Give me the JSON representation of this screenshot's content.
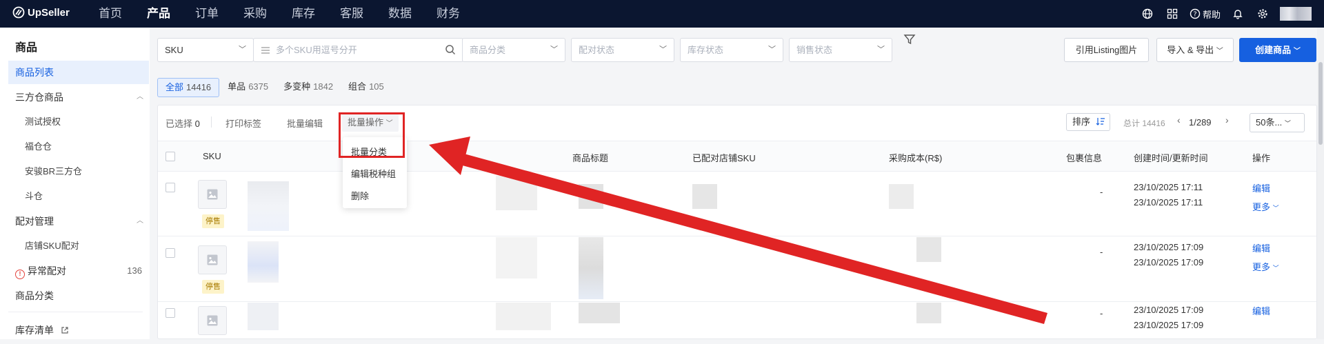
{
  "app": {
    "logo": "UpSeller"
  },
  "nav": [
    "首页",
    "产品",
    "订单",
    "采购",
    "库存",
    "客服",
    "数据",
    "财务"
  ],
  "nav_active": "产品",
  "topbar": {
    "help": "帮助"
  },
  "sidebar": {
    "title": "商品",
    "items": [
      {
        "label": "商品列表"
      },
      {
        "label": "三方仓商品"
      },
      {
        "label": "测试授权"
      },
      {
        "label": "福仓仓"
      },
      {
        "label": "安骏BR三方仓"
      },
      {
        "label": "斗仓"
      },
      {
        "label": "配对管理"
      },
      {
        "label": "店铺SKU配对"
      },
      {
        "label": "异常配对",
        "count": "136"
      },
      {
        "label": "商品分类"
      },
      {
        "label": "库存清单"
      }
    ]
  },
  "filters": {
    "sku_select": "SKU",
    "search_placeholder": "多个SKU用逗号分开",
    "category": "商品分类",
    "pair_status": "配对状态",
    "stock_status": "库存状态",
    "sale_status": "销售状态"
  },
  "buttons": {
    "listing_images": "引用Listing图片",
    "import_export": "导入 & 导出",
    "create": "创建商品"
  },
  "tabs": [
    {
      "label": "全部",
      "count": "14416"
    },
    {
      "label": "单品",
      "count": "6375"
    },
    {
      "label": "多变种",
      "count": "1842"
    },
    {
      "label": "组合",
      "count": "105"
    }
  ],
  "toolbar": {
    "selected_label": "已选择",
    "selected_count": "0",
    "print_labels": "打印标签",
    "bulk_edit": "批量编辑",
    "bulk_ops": "批量操作",
    "sort": "排序",
    "total": "总计 14416",
    "page": "1/289",
    "page_size": "50条..."
  },
  "columns": [
    "SKU",
    "商品标题",
    "已配对店铺SKU",
    "采购成本(R$)",
    "包裹信息",
    "创建时间/更新时间",
    "操作"
  ],
  "rows": [
    {
      "status": "停售",
      "package": "-",
      "created": "23/10/2025 17:11",
      "updated": "23/10/2025 17:11",
      "edit": "编辑",
      "more": "更多"
    },
    {
      "status": "停售",
      "package": "-",
      "created": "23/10/2025 17:09",
      "updated": "23/10/2025 17:09",
      "edit": "编辑",
      "more": "更多"
    },
    {
      "status": "",
      "package": "-",
      "created": "23/10/2025 17:09",
      "updated": "23/10/2025 17:09",
      "edit": "编辑",
      "more": ""
    }
  ],
  "dropdown": [
    "批量分类",
    "编辑税种组",
    "删除"
  ],
  "colors": {
    "topbar": "#0b1630",
    "primary": "#1660e0",
    "annotation": "#e02424"
  }
}
